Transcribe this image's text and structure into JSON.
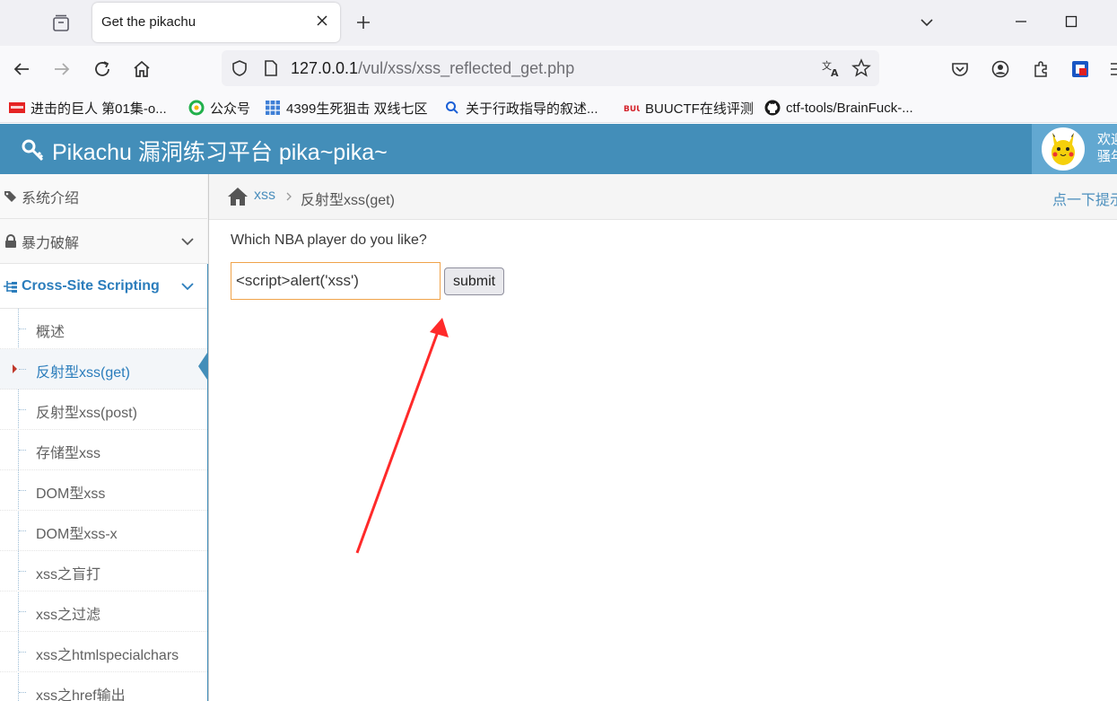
{
  "browser": {
    "tab_title": "Get the pikachu",
    "url_host": "127.0.0.1",
    "url_path": "/vul/xss/xss_reflected_get.php",
    "bookmarks": [
      {
        "label": "进击的巨人 第01集-o...",
        "icon": "red-film-icon"
      },
      {
        "label": "公众号",
        "icon": "wechat-icon"
      },
      {
        "label": "4399生死狙击 双线七区",
        "icon": "grid-icon"
      },
      {
        "label": "关于行政指导的叙述...",
        "icon": "search-icon"
      },
      {
        "label": "BUUCTF在线评测",
        "icon": "buuctf-icon"
      },
      {
        "label": "ctf-tools/BrainFuck-...",
        "icon": "github-icon"
      }
    ]
  },
  "header": {
    "title": "Pikachu 漏洞练习平台 pika~pika~",
    "user_line1": "欢迎",
    "user_line2": "骚年"
  },
  "sidebar": {
    "top_items": [
      {
        "label": "系统介绍",
        "icon": "tags-icon"
      },
      {
        "label": "暴力破解",
        "icon": "lock-icon"
      },
      {
        "label": "Cross-Site Scripting",
        "icon": "sitemap-icon"
      }
    ],
    "sub_items": [
      "概述",
      "反射型xss(get)",
      "反射型xss(post)",
      "存储型xss",
      "DOM型xss",
      "DOM型xss-x",
      "xss之盲打",
      "xss之过滤",
      "xss之htmlspecialchars",
      "xss之href输出"
    ],
    "active_index": 1
  },
  "breadcrumb": {
    "parent": "xss",
    "current": "反射型xss(get)",
    "tip": "点一下提示"
  },
  "form": {
    "question": "Which NBA player do you like?",
    "input_value": "<script>alert('xss')",
    "submit_label": "submit"
  },
  "colors": {
    "header_blue": "#438eb9",
    "link_blue": "#2b7dbc",
    "input_border": "#f0a34a",
    "annotation_arrow": "#ff2a2a"
  }
}
